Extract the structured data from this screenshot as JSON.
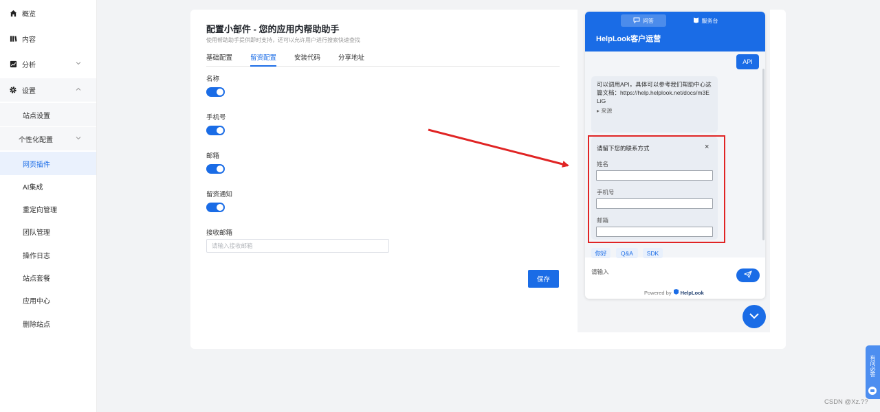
{
  "sidebar": {
    "items": [
      {
        "label": "概览",
        "icon": "home-icon"
      },
      {
        "label": "内容",
        "icon": "content-icon"
      },
      {
        "label": "分析",
        "icon": "chart-icon"
      },
      {
        "label": "设置",
        "icon": "gear-icon"
      }
    ],
    "sub": {
      "site_settings": "站点设置",
      "personalization": "个性化配置",
      "web_plugin": "网页插件",
      "ai": "AI集成",
      "redirect": "重定向管理",
      "team": "团队管理",
      "logs": "操作日志",
      "plan": "站点套餐",
      "apps": "应用中心",
      "delete": "删除站点"
    }
  },
  "page": {
    "title": "配置小部件 - 您的应用内帮助助手",
    "subtitle": "使用帮助助手提供即时支持，还可以允许用户进行搜索快速查找",
    "tabs": [
      "基础配置",
      "留资配置",
      "安装代码",
      "分享地址"
    ],
    "active_tab": "留资配置",
    "fields": {
      "name": "名称",
      "phone": "手机号",
      "email": "邮箱",
      "notify": "留资通知",
      "receiver": "接收邮箱"
    },
    "toggles": {
      "name": true,
      "phone": true,
      "email": true,
      "notify": true
    },
    "receiver_placeholder": "请输入接收邮箱",
    "save": "保存"
  },
  "widget": {
    "tabs": [
      "问答",
      "服务台"
    ],
    "title": "HelpLook客户运营",
    "user_message": "API",
    "bot_message": "可以调用API，具体可以参考我们帮助中心这篇文档：https://help.helplook.net/docs/m3ELiG",
    "source": "来源",
    "form": {
      "title": "请留下您的联系方式",
      "close": "×",
      "name": "姓名",
      "phone": "手机号",
      "email": "邮箱"
    },
    "quick": [
      "你好",
      "Q&A",
      "SDK"
    ],
    "input_placeholder": "请输入",
    "powered_by": "Powered by",
    "brand": "HelpLook"
  },
  "side_tab": "有问必答",
  "watermark": "CSDN @Xz.??",
  "colors": {
    "accent": "#1a6ce6",
    "highlight": "#e02424"
  }
}
